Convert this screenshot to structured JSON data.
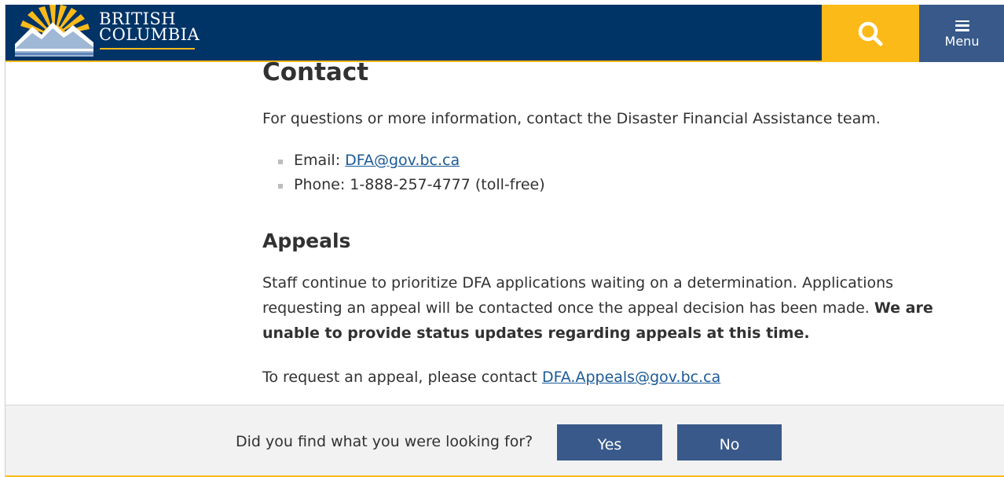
{
  "header": {
    "logo_line1": "BRITISH",
    "logo_line2": "COLUMBIA",
    "search_icon": "search-icon",
    "menu_label": "Menu",
    "colors": {
      "navy": "#003366",
      "gold": "#fcba19",
      "menu_blue": "#38598a"
    }
  },
  "contact": {
    "heading": "Contact",
    "intro": "For questions or more information, contact the Disaster Financial Assistance team.",
    "email_label": "Email: ",
    "email_link": "DFA@gov.bc.ca",
    "phone": "Phone: 1-888-257-4777 (toll-free)"
  },
  "appeals": {
    "heading": "Appeals",
    "paragraph": "Staff continue to prioritize DFA applications waiting on a determination. Applications requesting an appeal will be contacted once the appeal decision has been made. ",
    "paragraph_bold": "We are unable to provide status updates regarding appeals at this time.",
    "request_text": "To request an appeal, please contact ",
    "request_link": "DFA.Appeals@gov.bc.ca"
  },
  "feedback": {
    "question": "Did you find what you were looking for?",
    "yes_label": "Yes",
    "no_label": "No"
  }
}
